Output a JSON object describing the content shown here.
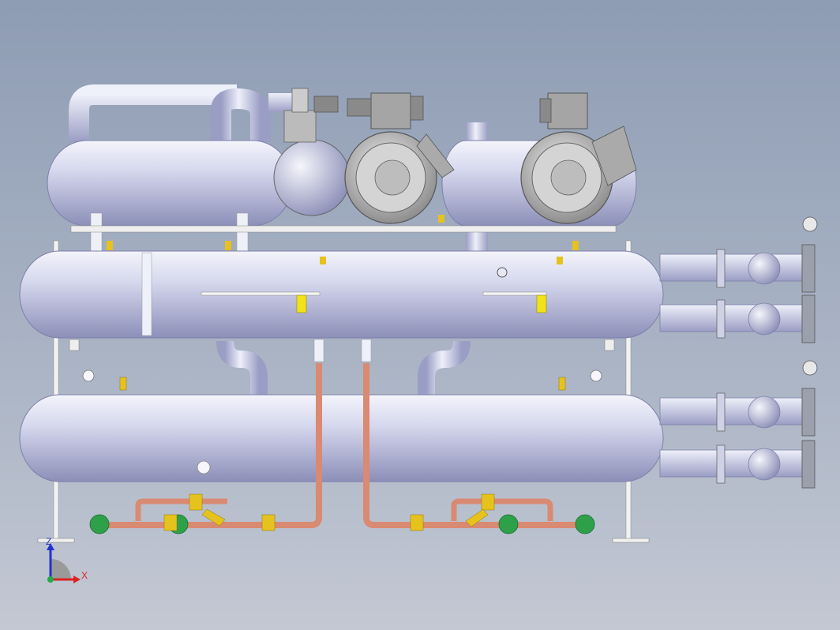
{
  "viewport": {
    "background_top": "#8e9cb4",
    "background_bottom": "#c3c8d3"
  },
  "model": {
    "vessel_color": "#d6d8ee",
    "copper_pipe_color": "#d98a72",
    "brass_fitting_color": "#e6c21e",
    "flange_color": "#9aa0ac",
    "compressor_color": "#c8c8c8",
    "valve_disc_color": "#2fa04a",
    "parts": [
      "top-left-oil-separator",
      "compressor-1",
      "compressor-2",
      "compressor-3",
      "condenser-shell",
      "evaporator-shell",
      "suction-header",
      "liquid-line-left",
      "liquid-line-right",
      "water-nozzles-right",
      "support-legs"
    ]
  },
  "triad": {
    "z_label": "Z",
    "x_label": "X",
    "z_color": "#2233cc",
    "x_color": "#dd2222"
  }
}
